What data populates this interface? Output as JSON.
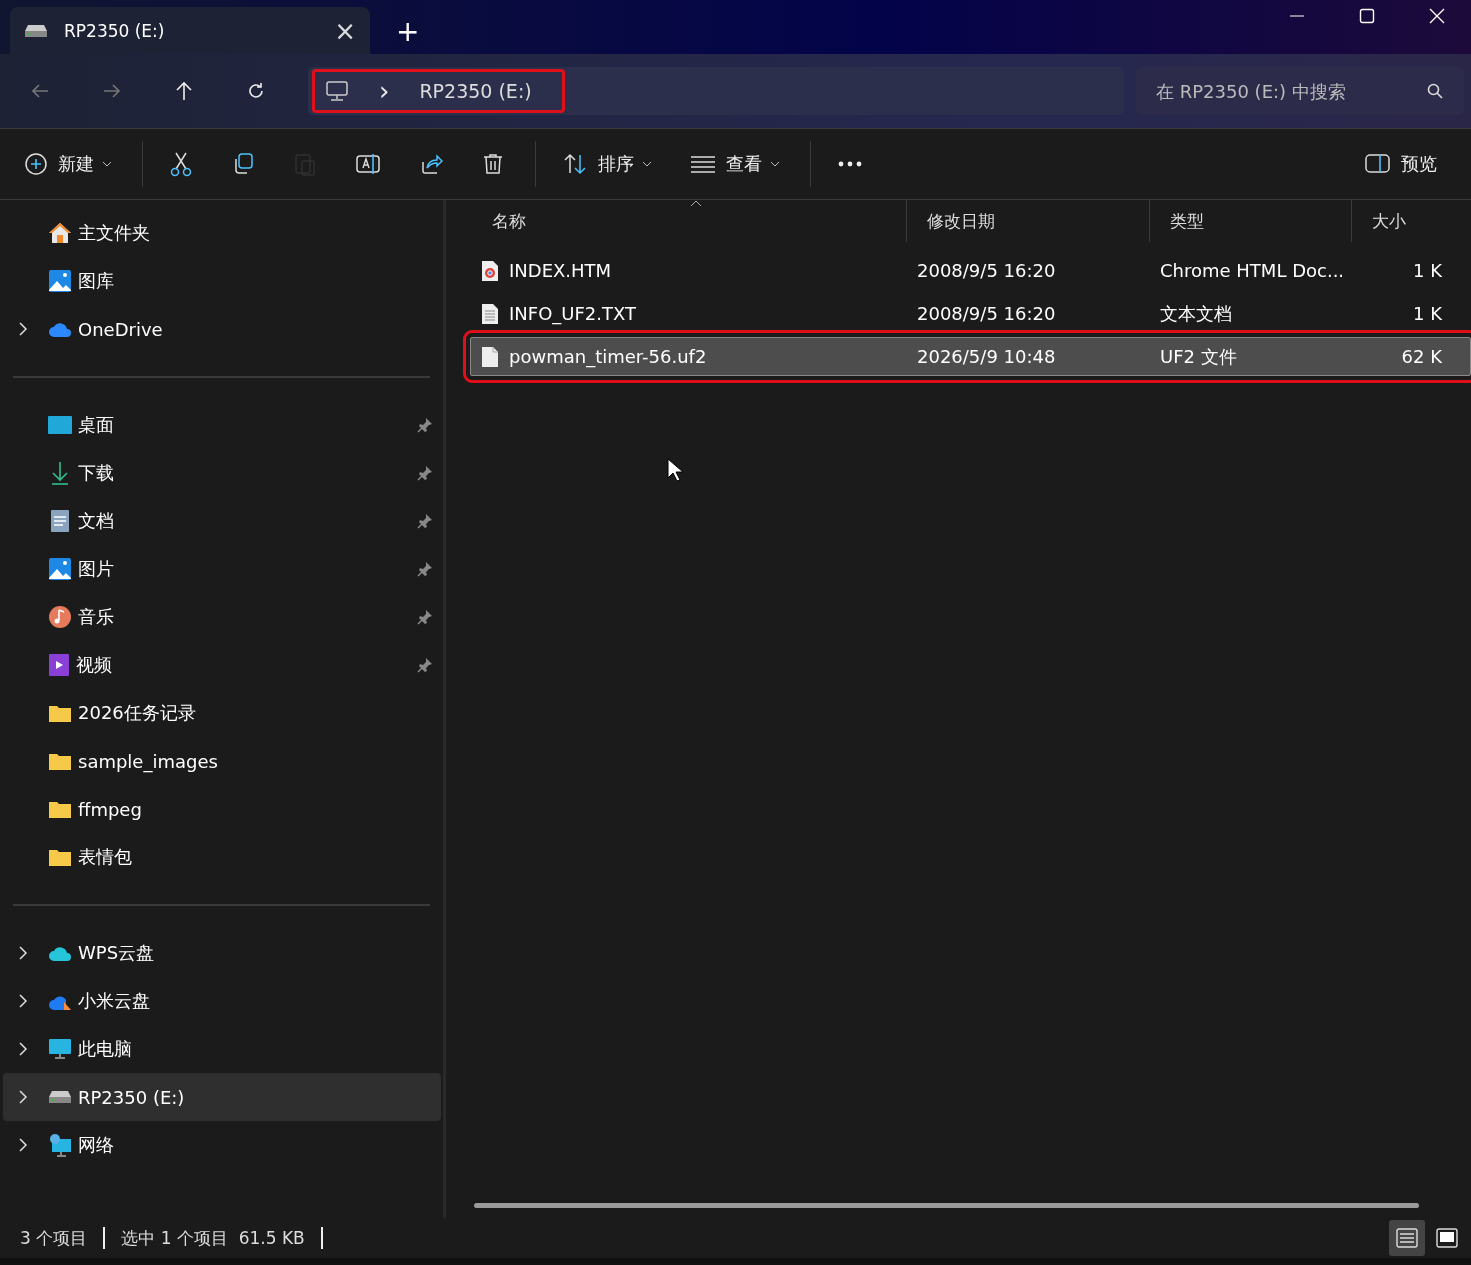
{
  "tab": {
    "title": "RP2350 (E:)",
    "close": "×",
    "new_tab": "+"
  },
  "address": {
    "crumb": "RP2350 (E:)",
    "separator": "›",
    "annotated": true
  },
  "search": {
    "placeholder": "在 RP2350 (E:) 中搜索"
  },
  "toolbar": [
    {
      "kind": "new",
      "label": "新建",
      "dropdown": true,
      "disabled": false
    },
    {
      "kind": "cut",
      "disabled": false
    },
    {
      "kind": "copy",
      "disabled": false
    },
    {
      "kind": "paste",
      "disabled": true
    },
    {
      "kind": "rename",
      "disabled": false
    },
    {
      "kind": "share",
      "disabled": false
    },
    {
      "kind": "delete",
      "disabled": false
    },
    {
      "kind": "sort",
      "label": "排序",
      "dropdown": true,
      "disabled": false
    },
    {
      "kind": "view",
      "label": "查看",
      "dropdown": true,
      "disabled": false
    },
    {
      "kind": "more",
      "disabled": false
    }
  ],
  "preview": {
    "label": "预览"
  },
  "sidebar": {
    "groups": [
      [
        {
          "kind": "home",
          "label": "主文件夹",
          "expandable": false,
          "pinned": false,
          "selected": false
        },
        {
          "kind": "gallery",
          "label": "图库",
          "expandable": false,
          "pinned": false,
          "selected": false
        },
        {
          "kind": "onedrive",
          "label": "OneDrive",
          "expandable": true,
          "pinned": false,
          "selected": false
        }
      ],
      [
        {
          "kind": "desktop",
          "label": "桌面",
          "expandable": false,
          "pinned": true,
          "selected": false
        },
        {
          "kind": "download",
          "label": "下载",
          "expandable": false,
          "pinned": true,
          "selected": false
        },
        {
          "kind": "documents",
          "label": "文档",
          "expandable": false,
          "pinned": true,
          "selected": false
        },
        {
          "kind": "pictures",
          "label": "图片",
          "expandable": false,
          "pinned": true,
          "selected": false
        },
        {
          "kind": "music",
          "label": "音乐",
          "expandable": false,
          "pinned": true,
          "selected": false
        },
        {
          "kind": "videos",
          "label": "视频",
          "expandable": false,
          "pinned": true,
          "selected": false
        },
        {
          "kind": "folder",
          "label": "2026任务记录",
          "expandable": false,
          "pinned": false,
          "selected": false
        },
        {
          "kind": "folder",
          "label": "sample_images",
          "expandable": false,
          "pinned": false,
          "selected": false
        },
        {
          "kind": "folder",
          "label": "ffmpeg",
          "expandable": false,
          "pinned": false,
          "selected": false
        },
        {
          "kind": "folder",
          "label": "表情包",
          "expandable": false,
          "pinned": false,
          "selected": false
        }
      ],
      [
        {
          "kind": "wps",
          "label": "WPS云盘",
          "expandable": true,
          "pinned": false,
          "selected": false
        },
        {
          "kind": "mi",
          "label": "小米云盘",
          "expandable": true,
          "pinned": false,
          "selected": false
        },
        {
          "kind": "computer",
          "label": "此电脑",
          "expandable": true,
          "pinned": false,
          "selected": false
        },
        {
          "kind": "drive",
          "label": "RP2350 (E:)",
          "expandable": true,
          "pinned": false,
          "selected": true
        },
        {
          "kind": "network",
          "label": "网络",
          "expandable": true,
          "pinned": false,
          "selected": false
        }
      ]
    ]
  },
  "table": {
    "columns": [
      {
        "label": "名称",
        "sorted": true
      },
      {
        "label": "修改日期",
        "sorted": false
      },
      {
        "label": "类型",
        "sorted": false
      },
      {
        "label": "大小",
        "sorted": false
      }
    ],
    "rows": [
      {
        "kind": "html",
        "name": "INDEX.HTM",
        "date": "2008/9/5 16:20",
        "type": "Chrome HTML Doc...",
        "size": "1 K",
        "selected": false,
        "annotated": false
      },
      {
        "kind": "text",
        "name": "INFO_UF2.TXT",
        "date": "2008/9/5 16:20",
        "type": "文本文档",
        "size": "1 K",
        "selected": false,
        "annotated": false
      },
      {
        "kind": "file",
        "name": "powman_timer-56.uf2",
        "date": "2026/5/9 10:48",
        "type": "UF2 文件",
        "size": "62 K",
        "selected": true,
        "annotated": true
      }
    ]
  },
  "status_bar": {
    "count": "3 个项目",
    "selection": "选中 1 个项目  61.5 KB"
  },
  "view_modes": [
    {
      "kind": "details",
      "selected": true
    },
    {
      "kind": "tiles",
      "selected": false
    }
  ]
}
